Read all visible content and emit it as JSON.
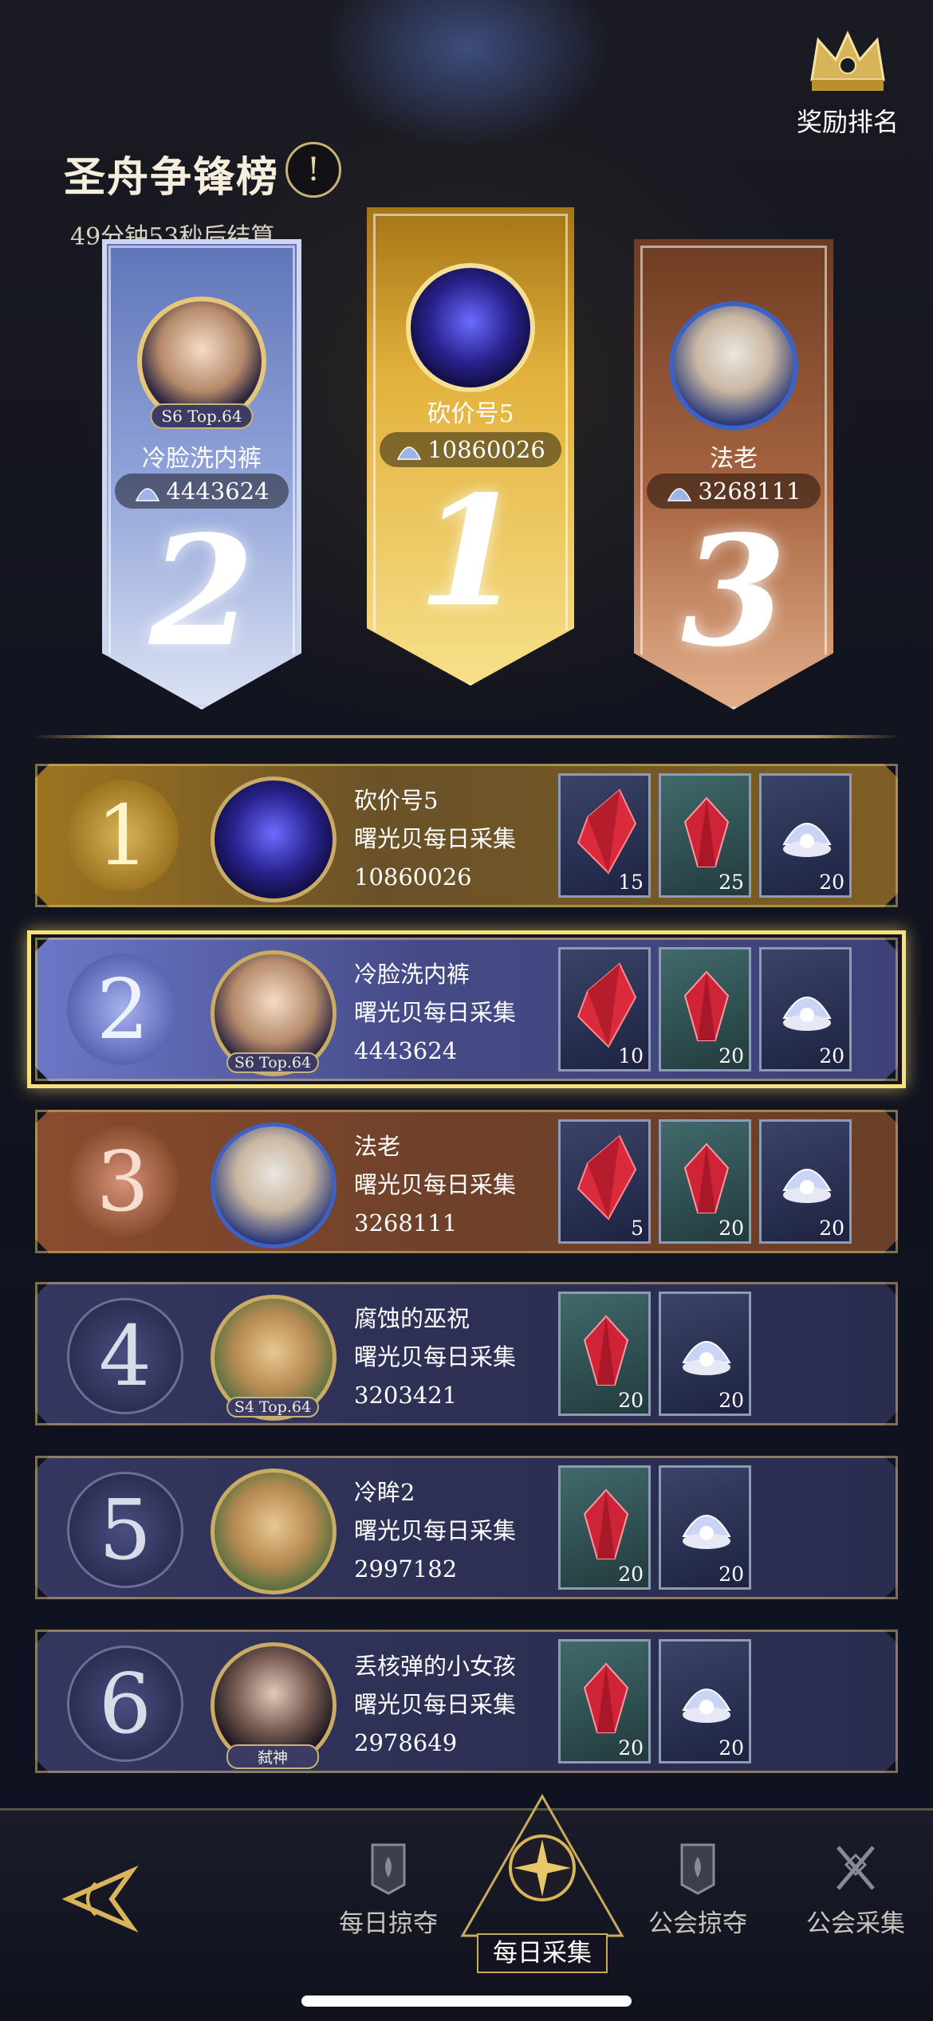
{
  "header": {
    "title": "圣舟争锋榜",
    "countdown": "49分钟53秒后结算",
    "info_icon": "!",
    "reward_label": "奖励排名"
  },
  "podium": [
    {
      "rank": "2",
      "name": "冷脸洗内裤",
      "score": "4443624",
      "tag": "S6 Top.64"
    },
    {
      "rank": "1",
      "name": "砍价号5",
      "score": "10860026",
      "tag": ""
    },
    {
      "rank": "3",
      "name": "法老",
      "score": "3268111",
      "tag": ""
    }
  ],
  "rows": [
    {
      "rank": "1",
      "name": "砍价号5",
      "task": "曙光贝每日采集",
      "score": "10860026",
      "tag": "",
      "rewards": [
        {
          "icon": "red-crystal-icon",
          "count": "15"
        },
        {
          "icon": "ruby-icon",
          "count": "25"
        },
        {
          "icon": "pearl-shell-icon",
          "count": "20"
        }
      ]
    },
    {
      "rank": "2",
      "name": "冷脸洗内裤",
      "task": "曙光贝每日采集",
      "score": "4443624",
      "tag": "S6 Top.64",
      "rewards": [
        {
          "icon": "red-crystal-icon",
          "count": "10"
        },
        {
          "icon": "ruby-icon",
          "count": "20"
        },
        {
          "icon": "pearl-shell-icon",
          "count": "20"
        }
      ]
    },
    {
      "rank": "3",
      "name": "法老",
      "task": "曙光贝每日采集",
      "score": "3268111",
      "tag": "",
      "rewards": [
        {
          "icon": "red-crystal-icon",
          "count": "5"
        },
        {
          "icon": "ruby-icon",
          "count": "20"
        },
        {
          "icon": "pearl-shell-icon",
          "count": "20"
        }
      ]
    },
    {
      "rank": "4",
      "name": "腐蚀的巫祝",
      "task": "曙光贝每日采集",
      "score": "3203421",
      "tag": "S4 Top.64",
      "rewards": [
        {
          "icon": "ruby-icon",
          "count": "20"
        },
        {
          "icon": "pearl-shell-icon",
          "count": "20"
        }
      ]
    },
    {
      "rank": "5",
      "name": "冷眸2",
      "task": "曙光贝每日采集",
      "score": "2997182",
      "tag": "",
      "rewards": [
        {
          "icon": "ruby-icon",
          "count": "20"
        },
        {
          "icon": "pearl-shell-icon",
          "count": "20"
        }
      ]
    },
    {
      "rank": "6",
      "name": "丢核弹的小女孩",
      "task": "曙光贝每日采集",
      "score": "2978649",
      "tag": "弑神",
      "rewards": [
        {
          "icon": "ruby-icon",
          "count": "20"
        },
        {
          "icon": "pearl-shell-icon",
          "count": "20"
        }
      ]
    }
  ],
  "nav": {
    "items": [
      "每日掠夺",
      "每日采集",
      "公会掠夺",
      "公会采集"
    ]
  },
  "colors": {
    "gold": "#c9a95a",
    "highlight": "#f7e27a",
    "background": "#0c0f1c"
  }
}
